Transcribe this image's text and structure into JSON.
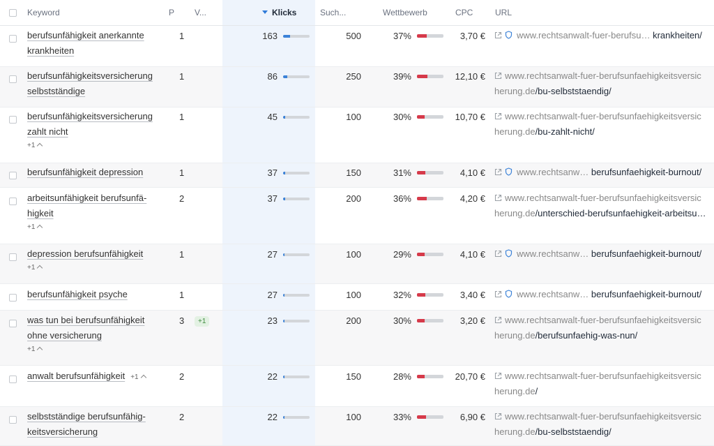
{
  "header": {
    "keyword": "Keyword",
    "position": "P",
    "volatility": "V...",
    "klicks": "Klicks",
    "search": "Such...",
    "competition": "Wettbewerb",
    "cpc": "CPC",
    "url": "URL"
  },
  "colors": {
    "accent": "#3b82d8",
    "competition": "#d63a4a",
    "klicks_column": "#eef4fc"
  },
  "rows": [
    {
      "kw_line1": "berufsunfähigkeit anerkannte",
      "kw_line2": "krankheiten",
      "more": "",
      "position": "1",
      "change": "",
      "klicks": "163",
      "klicks_fraction": 0.25,
      "search": "500",
      "competition": "37%",
      "competition_fraction": 0.37,
      "cpc": "3,70 €",
      "url_domain": "www.rechtsanwalt-fuer-berufsu…",
      "url_domain2": "",
      "url_path": " krankheiten/",
      "shield": true
    },
    {
      "kw_line1": "berufsunfähigkeitsversicherung",
      "kw_line2": "selbstständige",
      "more": "",
      "position": "1",
      "change": "",
      "klicks": "86",
      "klicks_fraction": 0.15,
      "search": "250",
      "competition": "39%",
      "competition_fraction": 0.39,
      "cpc": "12,10 €",
      "url_domain": "www.rechtsanwalt-fuer-berufsunfaehigkeitsversic",
      "url_domain2": "herung.de",
      "url_path": "/bu-selbststaendig/",
      "shield": false
    },
    {
      "kw_line1": "berufsunfähigkeitsversicherung",
      "kw_line2": "zahlt nicht",
      "more": "+1",
      "position": "1",
      "change": "",
      "klicks": "45",
      "klicks_fraction": 0.08,
      "search": "100",
      "competition": "30%",
      "competition_fraction": 0.3,
      "cpc": "10,70 €",
      "url_domain": "www.rechtsanwalt-fuer-berufsunfaehigkeitsversic",
      "url_domain2": "herung.de",
      "url_path": "/bu-zahlt-nicht/",
      "shield": false
    },
    {
      "kw_line1": "berufsunfähigkeit depression",
      "kw_line2": "",
      "more": "",
      "position": "1",
      "change": "",
      "klicks": "37",
      "klicks_fraction": 0.07,
      "search": "150",
      "competition": "31%",
      "competition_fraction": 0.31,
      "cpc": "4,10 €",
      "url_domain": "www.rechtsanw…",
      "url_domain2": "",
      "url_path": " berufsunfaehigkeit-burnout/",
      "shield": true
    },
    {
      "kw_line1": "arbeitsunfähigkeit berufsunfä-",
      "kw_line2": "higkeit",
      "more": "+1",
      "position": "2",
      "change": "",
      "klicks": "37",
      "klicks_fraction": 0.07,
      "search": "200",
      "competition": "36%",
      "competition_fraction": 0.36,
      "cpc": "4,20 €",
      "url_domain": "www.rechtsanwalt-fuer-berufsunfaehigkeitsversic",
      "url_domain2": "herung.de",
      "url_path": "/unterschied-berufsunfaehigkeit-arbeitsu…",
      "shield": false
    },
    {
      "kw_line1": "depression berufsunfähigkeit",
      "kw_line2": "",
      "more": "+1",
      "position": "1",
      "change": "",
      "klicks": "27",
      "klicks_fraction": 0.06,
      "search": "100",
      "competition": "29%",
      "competition_fraction": 0.29,
      "cpc": "4,10 €",
      "url_domain": "www.rechtsanw…",
      "url_domain2": "",
      "url_path": " berufsunfaehigkeit-burnout/",
      "shield": true
    },
    {
      "kw_line1": "berufsunfähigkeit psyche",
      "kw_line2": "",
      "more": "",
      "position": "1",
      "change": "",
      "klicks": "27",
      "klicks_fraction": 0.06,
      "search": "100",
      "competition": "32%",
      "competition_fraction": 0.32,
      "cpc": "3,40 €",
      "url_domain": "www.rechtsanw…",
      "url_domain2": "",
      "url_path": " berufsunfaehigkeit-burnout/",
      "shield": true
    },
    {
      "kw_line1": "was tun bei berufsunfähigkeit",
      "kw_line2": "ohne versicherung",
      "more": "+1",
      "position": "3",
      "change": "+1",
      "klicks": "23",
      "klicks_fraction": 0.05,
      "search": "200",
      "competition": "30%",
      "competition_fraction": 0.3,
      "cpc": "3,20 €",
      "url_domain": "www.rechtsanwalt-fuer-berufsunfaehigkeitsversic",
      "url_domain2": "herung.de",
      "url_path": "/berufsunfaehig-was-nun/",
      "shield": false
    },
    {
      "kw_line1": "anwalt berufsunfähigkeit",
      "kw_line2": "",
      "more_inline": "+1",
      "more": "",
      "position": "2",
      "change": "",
      "klicks": "22",
      "klicks_fraction": 0.05,
      "search": "150",
      "competition": "28%",
      "competition_fraction": 0.28,
      "cpc": "20,70 €",
      "url_domain": "www.rechtsanwalt-fuer-berufsunfaehigkeitsversic",
      "url_domain2": "herung.de",
      "url_path": "/",
      "shield": false
    },
    {
      "kw_line1": "selbstständige berufsunfähig-",
      "kw_line2": "keitsversicherung",
      "more": "",
      "position": "2",
      "change": "",
      "klicks": "22",
      "klicks_fraction": 0.05,
      "search": "100",
      "competition": "33%",
      "competition_fraction": 0.33,
      "cpc": "6,90 €",
      "url_domain": "www.rechtsanwalt-fuer-berufsunfaehigkeitsversic",
      "url_domain2": "herung.de",
      "url_path": "/bu-selbststaendig/",
      "shield": false
    }
  ]
}
